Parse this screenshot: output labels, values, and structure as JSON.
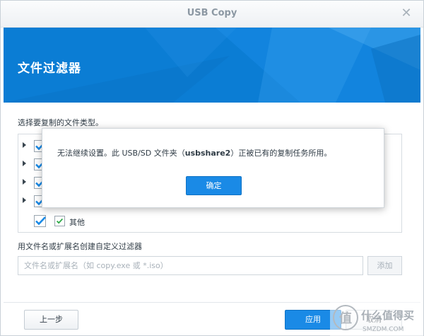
{
  "window": {
    "title": "USB Copy"
  },
  "banner": {
    "title": "文件过滤器"
  },
  "filetypes": {
    "label": "选择要复制的文件类型。",
    "items": [
      {
        "label": ""
      },
      {
        "label": ""
      },
      {
        "label": ""
      },
      {
        "label": ""
      },
      {
        "label": "其他"
      }
    ]
  },
  "custom_filter": {
    "label": "用文件名或扩展名创建自定义过滤器",
    "placeholder": "文件名或扩展名（如 copy.exe 或 *.iso）",
    "add_label": "添加"
  },
  "footer": {
    "back_label": "上一步",
    "apply_label": "应用",
    "cancel_label": "取消"
  },
  "dialog": {
    "message_prefix": "无法继续设置。此 USB/SD 文件夹（",
    "message_share": "usbshare2",
    "message_suffix": "）正被已有的复制任务所用。",
    "ok_label": "确定"
  },
  "watermark": {
    "text": "什么值得买",
    "url_text": "SMZDM.COM"
  },
  "colors": {
    "accent": "#1a8ae6",
    "banner": "#0b7dd4"
  }
}
